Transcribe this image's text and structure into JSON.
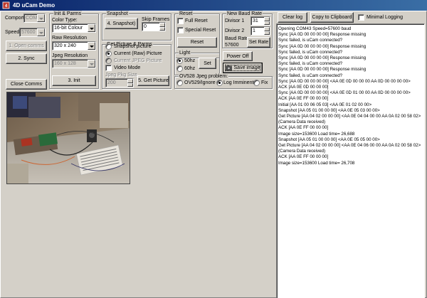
{
  "window": {
    "title": "4D uCam Demo"
  },
  "comport": {
    "label": "Comport",
    "value": "COM43"
  },
  "speed": {
    "label": "Speed",
    "value": "57600"
  },
  "buttons_left": {
    "open_comms": "1. Open comms",
    "sync": "2. Sync",
    "close_comms": "Close Comms",
    "init": "3. Init"
  },
  "init_parms": {
    "group_label": "Init & Parms",
    "color_type_label": "Color Type:",
    "color_type_value": "16-bit Colour",
    "raw_res_label": "Raw Resolution",
    "raw_res_value": "320 x 240",
    "jpeg_res_label": "Jpeg Resolution",
    "jpeg_res_value": "160 x 128"
  },
  "snapshot": {
    "group_label": "Snapshot",
    "button": "4. Snapshot)",
    "skip_frames_label": "Skip Frames",
    "skip_frames_value": "0"
  },
  "get_picture": {
    "group_label": "Get Picture & Parms",
    "opt_snapshot": "Snapshot picture",
    "opt_current_raw": "Current (Raw) Picture",
    "opt_current_jpeg": "Current JPEG Picture",
    "opt_video": "Video Mode",
    "jpeg_pkg_label": "Jpeg Pkg Size",
    "jpeg_pkg_value": "200",
    "button": "5. Get Picture"
  },
  "reset": {
    "group_label": "Reset",
    "full_reset": "Full Reset",
    "special_reset": "Special Reset",
    "button": "Reset"
  },
  "baud": {
    "group_label": "New Baud Rate",
    "divisor1_label": "Divisor 1",
    "divisor1_value": "31",
    "divisor2_label": "Divisor 2",
    "divisor2_value": "1",
    "baud_rate_label": "Baud Rate",
    "baud_rate_value": "57600",
    "set_rate_button": "Set Rate"
  },
  "light": {
    "group_label": "Light",
    "opt_50": "50hz",
    "opt_60": "60hz",
    "set_button": "Set"
  },
  "power": {
    "power_off_button": "Power Off",
    "save_image_button": "Save image"
  },
  "ov528": {
    "group_label": "OV528 Jpeg problem:",
    "opt_ignore": "OV529/Ignore",
    "opt_log": "Log Imminent",
    "opt_fix": "Fix"
  },
  "right_toolbar": {
    "clear_log": "Clear log",
    "copy_clipboard": "Copy to Clipboard",
    "minimal_logging": "Minimal Logging"
  },
  "log_lines": [
    "Opening COM43 Speed=57600 baud",
    "Sync [AA 0D 00 00 00 00] Response missing",
    "Sync failed, is uCam connected?",
    "Sync [AA 0D 00 00 00 00] Response missing",
    "Sync failed, is uCam connected?",
    "Sync [AA 0D 00 00 00 00] Response missing",
    "Sync failed, is uCam connected?",
    "Sync [AA 0D 00 00 00 00] Response missing",
    "Sync failed, is uCam connected?",
    "Sync [AA 0D 00 00 00 00] <AA 0E 0D 00 00 00 AA 0D 00 00 00 00>",
    "ACK [AA 0E 0D 00 00 00]",
    "Sync [AA 0D 00 00 00 00] <AA 0E 0D 01 00 00 AA 0D 00 00 00 00>",
    "ACK [AA 0E FF 00 00 00]",
    "Initial [AA 01 00 06 05 03] <AA 0E 01 02 00 00>",
    "Snapshot [AA 05 01 00 00 00] <AA 0E 05 03 00 00>",
    "Get Picture [AA 04 02 00 00 00] <AA 0E 04 04 00 00 AA 0A 02 00 58 02>",
    "(Camera Data received)",
    "ACK [AA 0E FF 00 00 00]",
    "Image size=153600 Load time= 26,688",
    "Snapshot [AA 05 01 00 00 00] <AA 0E 05 05 00 00>",
    "Get Picture [AA 04 02 00 00 00] <AA 0E 04 06 00 00 AA 0A 02 00 58 02>",
    "(Camera Data received)",
    "ACK [AA 0E FF 00 00 00]",
    "Image size=153600 Load time= 26,708"
  ],
  "photo": {
    "alt": ""
  }
}
